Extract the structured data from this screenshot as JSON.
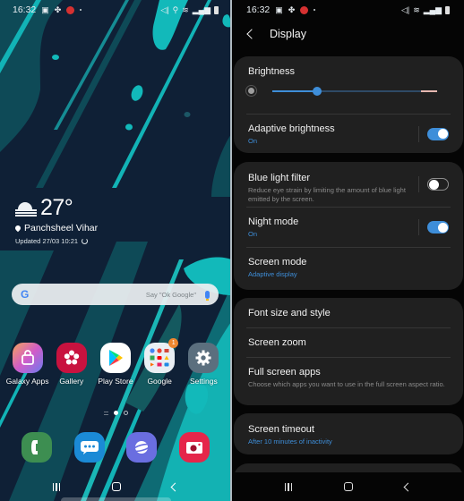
{
  "home": {
    "status_bar": {
      "time": "16:32",
      "icons": [
        "gallery-icon",
        "pinwheel-icon",
        "app-notification-icon",
        "dot-icon"
      ],
      "right_icons": [
        "mute-vibrate-icon",
        "location-icon",
        "wifi-icon",
        "signal-icon",
        "battery-icon"
      ]
    },
    "weather": {
      "temperature": "27°",
      "location": "Panchsheel Vihar",
      "updated": "Updated 27/03 10:21",
      "condition_icon": "fog-icon"
    },
    "search": {
      "logo": "G",
      "placeholder": "Say \"Ok Google\""
    },
    "apps": [
      {
        "label": "Galaxy Apps",
        "icon": "shopping-bag-icon",
        "color": "#c861d8"
      },
      {
        "label": "Gallery",
        "icon": "flower-icon",
        "color": "#c8123f"
      },
      {
        "label": "Play Store",
        "icon": "play-icon",
        "color": "#ffffff"
      },
      {
        "label": "Google",
        "icon": "folder-icon",
        "color": "#e9eef3",
        "badge": "1"
      },
      {
        "label": "Settings",
        "icon": "gear-icon",
        "color": "#5b6f7e"
      }
    ],
    "page_indicator": {
      "pages": 2,
      "current": 1
    },
    "dock": [
      {
        "name": "phone",
        "icon": "phone-icon",
        "color": "#3d8e51"
      },
      {
        "name": "messages",
        "icon": "chat-icon",
        "color": "#1b8ad6"
      },
      {
        "name": "internet",
        "icon": "planet-icon",
        "color": "#6a6ee0"
      },
      {
        "name": "camera",
        "icon": "camera-icon",
        "color": "#e5264a"
      }
    ]
  },
  "settings": {
    "status_bar": {
      "time": "16:32"
    },
    "title": "Display",
    "brightness": {
      "label": "Brightness",
      "level": 0.27
    },
    "adaptive_brightness": {
      "title": "Adaptive brightness",
      "status": "On",
      "enabled": true
    },
    "blue_light_filter": {
      "title": "Blue light filter",
      "description": "Reduce eye strain by limiting the amount of blue light emitted by the screen.",
      "enabled": false
    },
    "night_mode": {
      "title": "Night mode",
      "status": "On",
      "enabled": true
    },
    "screen_mode": {
      "title": "Screen mode",
      "value": "Adaptive display"
    },
    "font_size": {
      "title": "Font size and style"
    },
    "screen_zoom": {
      "title": "Screen zoom"
    },
    "full_screen_apps": {
      "title": "Full screen apps",
      "description": "Choose which apps you want to use in the full screen aspect ratio."
    },
    "screen_timeout": {
      "title": "Screen timeout",
      "value": "After 10 minutes of inactivity"
    },
    "accent_color": "#3e8ed9"
  }
}
